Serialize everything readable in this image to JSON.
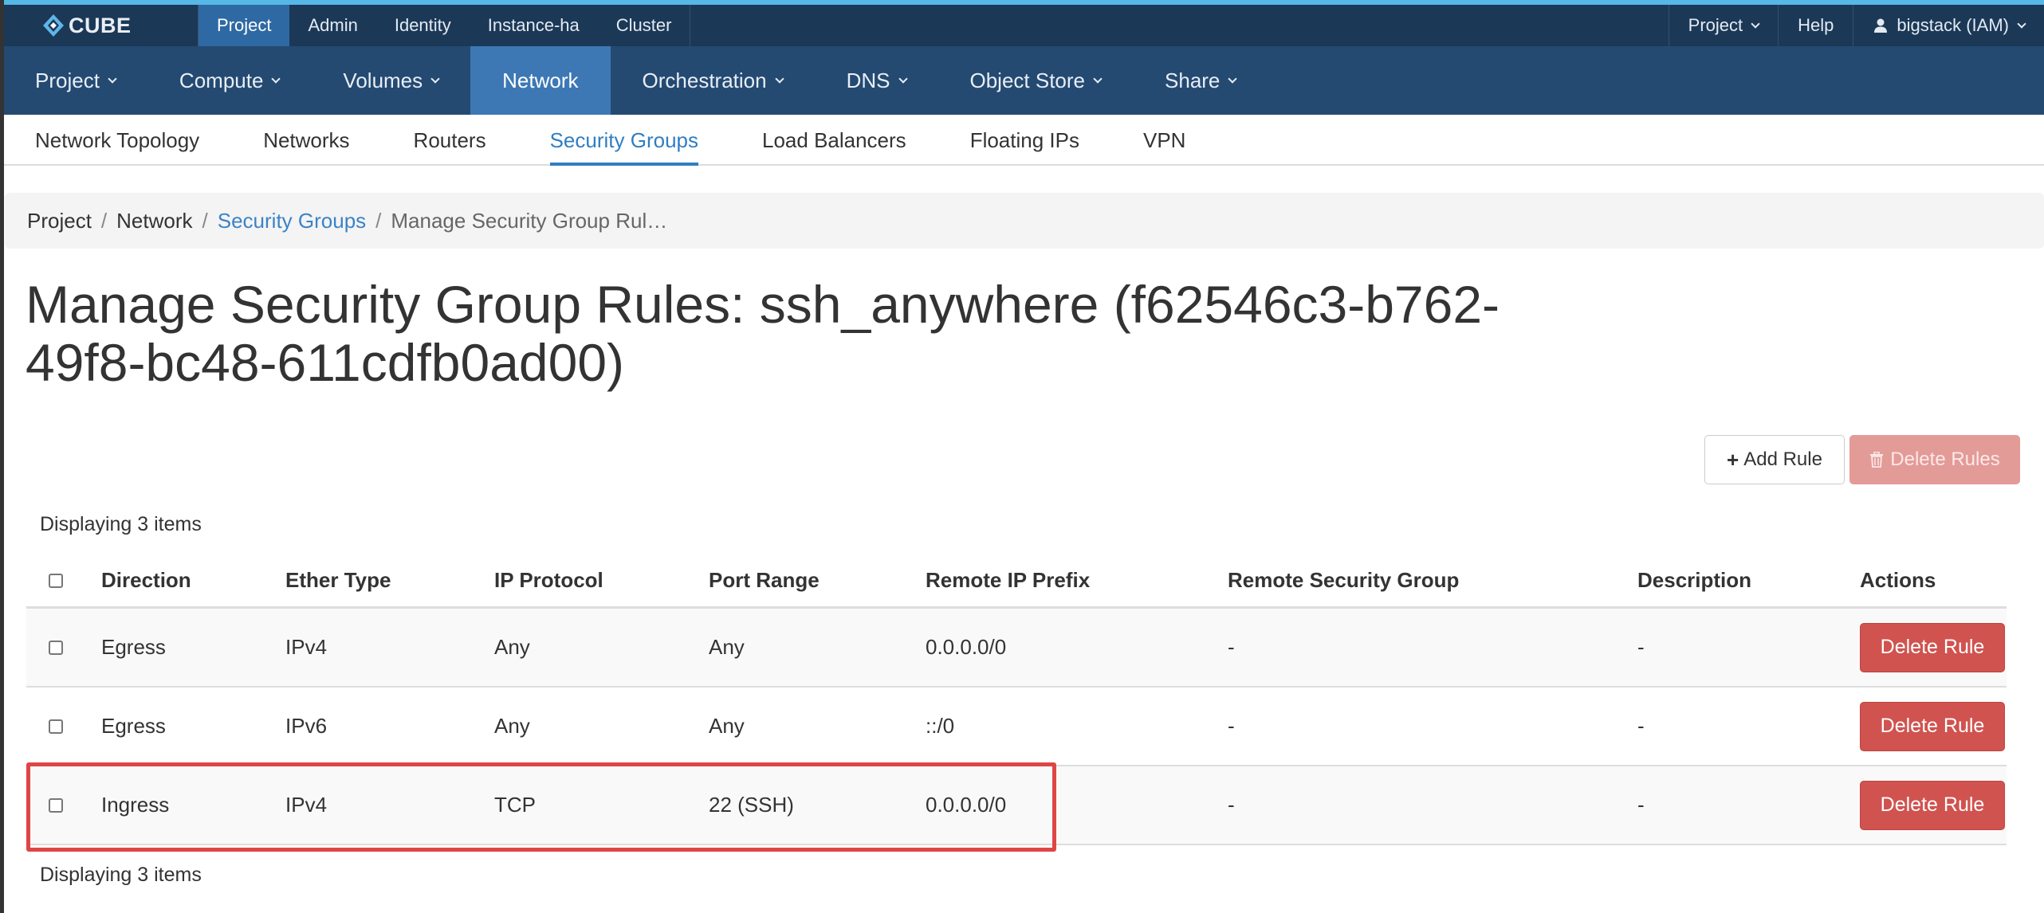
{
  "topbar": {
    "logo_text": "CUBE",
    "tabs": [
      {
        "label": "Project",
        "active": true
      },
      {
        "label": "Admin",
        "active": false
      },
      {
        "label": "Identity",
        "active": false
      },
      {
        "label": "Instance-ha",
        "active": false
      },
      {
        "label": "Cluster",
        "active": false
      }
    ],
    "right": {
      "project_menu": "Project",
      "help": "Help",
      "user": "bigstack (IAM)"
    }
  },
  "nav": {
    "items": [
      {
        "label": "Project",
        "dropdown": true
      },
      {
        "label": "Compute",
        "dropdown": true
      },
      {
        "label": "Volumes",
        "dropdown": true
      },
      {
        "label": "Network",
        "dropdown": false,
        "active": true
      },
      {
        "label": "Orchestration",
        "dropdown": true
      },
      {
        "label": "DNS",
        "dropdown": true
      },
      {
        "label": "Object Store",
        "dropdown": true
      },
      {
        "label": "Share",
        "dropdown": true
      }
    ]
  },
  "subnav": {
    "items": [
      {
        "label": "Network Topology"
      },
      {
        "label": "Networks"
      },
      {
        "label": "Routers"
      },
      {
        "label": "Security Groups",
        "active": true
      },
      {
        "label": "Load Balancers"
      },
      {
        "label": "Floating IPs"
      },
      {
        "label": "VPN"
      }
    ]
  },
  "breadcrumb": {
    "items": [
      "Project",
      "Network",
      "Security Groups",
      "Manage Security Group Rul…"
    ]
  },
  "page": {
    "title": "Manage Security Group Rules: ssh_anywhere (f62546c3-b762-49f8-bc48-611cdfb0ad00)"
  },
  "actions": {
    "add_rule": "Add Rule",
    "delete_rules": "Delete Rules"
  },
  "table": {
    "count_text": "Displaying 3 items",
    "headers": [
      "Direction",
      "Ether Type",
      "IP Protocol",
      "Port Range",
      "Remote IP Prefix",
      "Remote Security Group",
      "Description",
      "Actions"
    ],
    "rows": [
      {
        "direction": "Egress",
        "ether_type": "IPv4",
        "ip_protocol": "Any",
        "port_range": "Any",
        "remote_ip_prefix": "0.0.0.0/0",
        "remote_security_group": "-",
        "description": "-",
        "action": "Delete Rule"
      },
      {
        "direction": "Egress",
        "ether_type": "IPv6",
        "ip_protocol": "Any",
        "port_range": "Any",
        "remote_ip_prefix": "::/0",
        "remote_security_group": "-",
        "description": "-",
        "action": "Delete Rule"
      },
      {
        "direction": "Ingress",
        "ether_type": "IPv4",
        "ip_protocol": "TCP",
        "port_range": "22 (SSH)",
        "remote_ip_prefix": "0.0.0.0/0",
        "remote_security_group": "-",
        "description": "-",
        "action": "Delete Rule"
      }
    ]
  },
  "colors": {
    "topbar_bg": "#1c3857",
    "navbar_bg": "#244a72",
    "active_blue": "#3d78b5",
    "link_blue": "#2f7ec2",
    "danger": "#d0534f",
    "highlight_border": "#e04545"
  }
}
